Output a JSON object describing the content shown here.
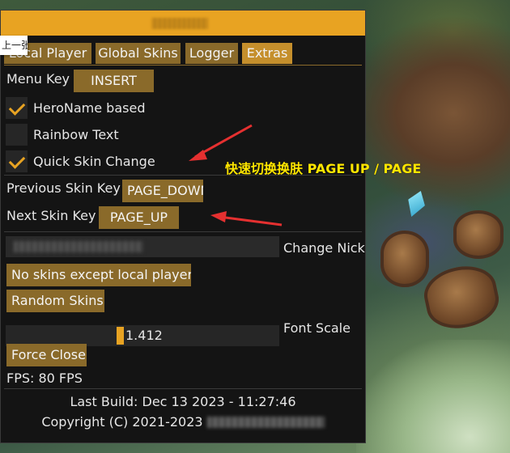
{
  "viewer": {
    "tab_label": "上一张"
  },
  "menu": {
    "tabs": [
      {
        "label": "Local Player"
      },
      {
        "label": "Global Skins"
      },
      {
        "label": "Logger"
      },
      {
        "label": "Extras",
        "active": true
      }
    ],
    "menu_key": {
      "label": "Menu Key",
      "value": "INSERT"
    },
    "options": [
      {
        "label": "HeroName based",
        "checked": true
      },
      {
        "label": "Rainbow Text",
        "checked": false
      },
      {
        "label": "Quick Skin Change",
        "checked": true
      }
    ],
    "previous_skin_key": {
      "label": "Previous Skin Key",
      "value": "PAGE_DOWN"
    },
    "next_skin_key": {
      "label": "Next Skin Key",
      "value": "PAGE_UP"
    },
    "change_nick": {
      "label": "Change Nick"
    },
    "buttons": {
      "no_skins": "No skins except local player",
      "random_skins": "Random Skins",
      "force_close": "Force Close"
    },
    "font_scale": {
      "label": "Font Scale",
      "value": "1.412"
    },
    "fps": "FPS: 80 FPS",
    "last_build": "Last Build: Dec 13 2023 - 11:27:46",
    "copyright": "Copyright (C) 2021-2023"
  },
  "annotation": {
    "text": "快速切换换肤 PAGE UP / PAGE",
    "color": "#ffe600",
    "arrow_color": "#e53030"
  },
  "colors": {
    "accent": "#e8a322",
    "button": "#8a6a2a",
    "active_tab": "#c58f2c",
    "panel_bg": "#141414"
  }
}
